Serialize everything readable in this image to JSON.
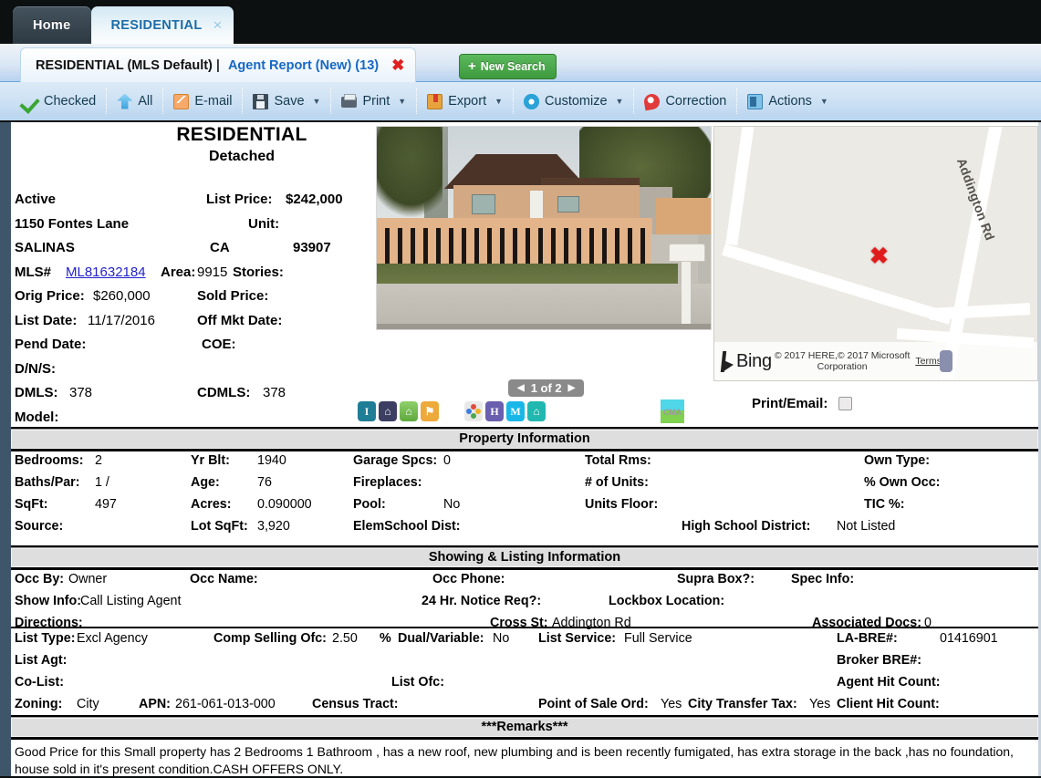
{
  "browser_tabs": [
    {
      "label": "Home",
      "active": false
    },
    {
      "label": "RESIDENTIAL",
      "active": true,
      "close": "×"
    }
  ],
  "search_tab": {
    "title": "RESIDENTIAL (MLS Default)",
    "separator": "|",
    "report": "Agent Report (New) (13)",
    "close": "✖"
  },
  "new_search_button": {
    "plus": "+",
    "label": "New Search"
  },
  "toolbar": [
    {
      "label": "Checked",
      "icon": "green-check-icon",
      "caret": false
    },
    {
      "label": "All",
      "icon": "blue-up-arrow-icon",
      "caret": false
    },
    {
      "label": "E-mail",
      "icon": "envelope-icon",
      "caret": false
    },
    {
      "label": "Save",
      "icon": "floppy-disk-icon",
      "caret": true
    },
    {
      "label": "Print",
      "icon": "printer-icon",
      "caret": true
    },
    {
      "label": "Export",
      "icon": "export-icon",
      "caret": true
    },
    {
      "label": "Customize",
      "icon": "gear-icon",
      "caret": true
    },
    {
      "label": "Correction",
      "icon": "correction-icon",
      "caret": false
    },
    {
      "label": "Actions",
      "icon": "actions-icon",
      "caret": true
    }
  ],
  "report": {
    "title": "RESIDENTIAL",
    "subtitle": "Detached",
    "status": "Active",
    "list_price_label": "List Price:",
    "list_price": "$242,000",
    "address": "1150 Fontes Lane",
    "unit_label": "Unit:",
    "unit": "",
    "city": "SALINAS",
    "state": "CA",
    "zip": "93907",
    "mls_label": "MLS#",
    "mls_number": "ML81632184",
    "area_label": "Area:",
    "area": "9915",
    "stories_label": "Stories:",
    "stories": "",
    "orig_price_label": "Orig Price:",
    "orig_price": "$260,000",
    "sold_price_label": "Sold Price:",
    "sold_price": "",
    "list_date_label": "List Date:",
    "list_date": "11/17/2016",
    "off_mkt_label": "Off Mkt Date:",
    "off_mkt_date": "",
    "pend_date_label": "Pend Date:",
    "pend_date": "",
    "coe_label": "COE:",
    "coe": "",
    "dns_label": "D/N/S:",
    "dns": "",
    "dmls_label": "DMLS:",
    "dmls": "378",
    "cdmls_label": "CDMLS:",
    "cdmls": "378",
    "model_label": "Model:",
    "model": ""
  },
  "photo": {
    "pager_prev": "◀",
    "pager_text": "1 of 2",
    "pager_next": "▶",
    "alt": "single-story tan house with wooden picket fence"
  },
  "mini_icons": [
    {
      "name": "info-icon",
      "glyph": "I",
      "style": "i"
    },
    {
      "name": "house-navy-icon",
      "glyph": "⌂",
      "style": "navy"
    },
    {
      "name": "house-green-icon",
      "glyph": "⌂",
      "style": "green"
    },
    {
      "name": "flag-icon",
      "glyph": "⚑",
      "style": "orange"
    },
    {
      "name": "color-dots-icon",
      "glyph": "",
      "style": "dots"
    },
    {
      "name": "history-icon",
      "glyph": "H",
      "style": "purple"
    },
    {
      "name": "map-icon",
      "glyph": "M",
      "style": "cyan"
    },
    {
      "name": "house-teal-icon",
      "glyph": "⌂",
      "style": "teal"
    }
  ],
  "cma_icon": {
    "label": "CMA"
  },
  "map": {
    "street_label": "Addington Rd",
    "marker": "✖",
    "bing_label": "Bing",
    "attribution_line1": "© 2017 HERE,© 2017 Microsoft",
    "attribution_line2": "Corporation",
    "terms": "Terms"
  },
  "print_email": {
    "label": "Print/Email:",
    "checked": false
  },
  "property_information": {
    "heading": "Property Information",
    "rows": [
      [
        {
          "k": "Bedrooms:",
          "v": "2"
        },
        {
          "k": "Yr Blt:",
          "v": "1940"
        },
        {
          "k": "Garage Spcs:",
          "v": "0"
        },
        {
          "k": "Total Rms:",
          "v": ""
        },
        {
          "k": "Own Type:",
          "v": ""
        }
      ],
      [
        {
          "k": "Baths/Par:",
          "v": "1    /"
        },
        {
          "k": "Age:",
          "v": "76"
        },
        {
          "k": "Fireplaces:",
          "v": ""
        },
        {
          "k": "# of Units:",
          "v": ""
        },
        {
          "k": "% Own Occ:",
          "v": ""
        }
      ],
      [
        {
          "k": "SqFt:",
          "v": "497"
        },
        {
          "k": "Acres:",
          "v": "0.090000"
        },
        {
          "k": "Pool:",
          "v": "No"
        },
        {
          "k": "Units Floor:",
          "v": ""
        },
        {
          "k": "TIC %:",
          "v": ""
        }
      ],
      [
        {
          "k": "Source:",
          "v": ""
        },
        {
          "k": "Lot SqFt:",
          "v": "3,920"
        },
        {
          "k": "ElemSchool Dist:",
          "v": ""
        },
        {
          "k": "High School District:",
          "v": "Not Listed"
        }
      ]
    ]
  },
  "showing_information": {
    "heading": "Showing & Listing Information",
    "rows": [
      [
        {
          "k": "Occ By:",
          "v": "Owner"
        },
        {
          "k": "Occ Name:",
          "v": ""
        },
        {
          "k": "Occ Phone:",
          "v": ""
        },
        {
          "k": "Supra Box?:",
          "v": ""
        },
        {
          "k": "Spec Info:",
          "v": ""
        }
      ],
      [
        {
          "k": "Show Info:",
          "v": "Call Listing Agent"
        },
        {
          "k": "24 Hr. Notice Req?:",
          "v": ""
        },
        {
          "k": "Lockbox Location:",
          "v": ""
        }
      ],
      [
        {
          "k": "Directions:",
          "v": ""
        },
        {
          "k": "Cross St:",
          "v": "Addington Rd"
        },
        {
          "k": "Associated Docs:",
          "v": "0"
        }
      ]
    ]
  },
  "listing_details": {
    "rows": [
      [
        {
          "k": "List Type:",
          "v": "Excl Agency"
        },
        {
          "k": "Comp Selling Ofc:",
          "v": "2.50"
        },
        {
          "k": "%",
          "v": ""
        },
        {
          "k": "Dual/Variable:",
          "v": "No"
        },
        {
          "k": "List Service:",
          "v": "Full Service"
        },
        {
          "k": "LA-BRE#:",
          "v": "01416901"
        }
      ],
      [
        {
          "k": "List Agt:",
          "v": ""
        },
        {
          "k": "Broker BRE#:",
          "v": ""
        }
      ],
      [
        {
          "k": "Co-List:",
          "v": ""
        },
        {
          "k": "List Ofc:",
          "v": ""
        },
        {
          "k": "Agent Hit Count:",
          "v": ""
        }
      ],
      [
        {
          "k": "Zoning:",
          "v": "City"
        },
        {
          "k": "APN:",
          "v": "261-061-013-000"
        },
        {
          "k": "Census Tract:",
          "v": ""
        },
        {
          "k": "Point of Sale Ord:",
          "v": "Yes"
        },
        {
          "k": "City Transfer Tax:",
          "v": "Yes"
        },
        {
          "k": "Client Hit Count:",
          "v": ""
        }
      ]
    ]
  },
  "remarks": {
    "heading": "***Remarks***",
    "text": "Good Price for this Small property has 2 Bedrooms 1 Bathroom , has a new roof, new plumbing and is been recently fumigated, has extra storage in the back ,has no foundation, house sold in it's present condition.CASH OFFERS ONLY."
  },
  "colors": {
    "window_frame": "#3f556a",
    "toolbar_blue": "#cfe2f4",
    "band_gray": "#dedede",
    "link_blue": "#2222cc",
    "accent_green": "#3d9a3d",
    "marker_red": "#e01b1b"
  }
}
